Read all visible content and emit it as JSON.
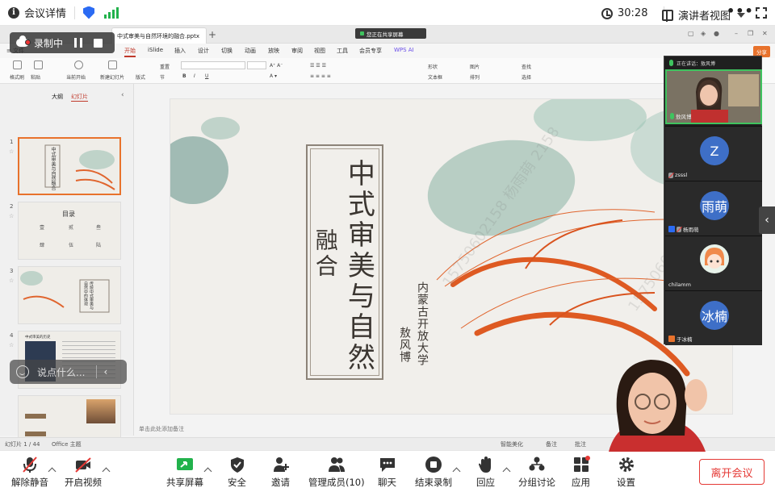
{
  "topbar": {
    "title": "会议详情",
    "timer": "30:28",
    "view_label": "演讲者视图",
    "more": "•••"
  },
  "recording": {
    "label": "录制中"
  },
  "wps": {
    "doc_tab": "中式审美与自然环境的融合.pptx",
    "share_banner": "您正在共享屏幕",
    "tabs": [
      "开始",
      "iSlide",
      "插入",
      "设计",
      "切换",
      "动画",
      "放映",
      "审阅",
      "视图",
      "工具",
      "会员专享",
      "WPS AI"
    ],
    "active_tab": "开始",
    "share_button": "分享",
    "ribbon": {
      "from_current": "当前开始",
      "new_slide": "新建幻灯片",
      "format_painter": "格式刷",
      "paste": "粘贴",
      "layout": "版式",
      "section": "节",
      "reset": "重置",
      "shape": "形状",
      "picture": "图片",
      "textbox": "文本框",
      "arrange": "排列",
      "find": "查找",
      "select": "选择"
    },
    "pane_tabs": [
      "大纲",
      "幻灯片"
    ],
    "active_pane_tab": "幻灯片",
    "thumbnails": [
      {
        "num": "1",
        "title": "中式审美与自然融合"
      },
      {
        "num": "2",
        "title": "目录",
        "items": [
          "叁",
          "贰",
          "壹",
          "肆",
          "伍",
          "陆"
        ]
      },
      {
        "num": "3",
        "title": "传统中式审美与自然中的体现"
      },
      {
        "num": "4",
        "title": "中式审美的历史"
      }
    ],
    "notes_placeholder": "单击此处添加备注",
    "status": {
      "slide_count": "幻灯片 1 / 44",
      "theme": "Office 主题",
      "beautify": "智能美化",
      "notes": "备注",
      "comments": "批注"
    }
  },
  "slide": {
    "title_line1": "中式审美与自然",
    "title_line2": "融合",
    "affiliation": "内蒙古开放大学",
    "author": "敖风博",
    "watermark": "15750602158 杨雨萌 2158"
  },
  "chat": {
    "placeholder": "说点什么..."
  },
  "participants": {
    "header": "正在讲话：敖风博",
    "list": [
      {
        "name": "敖风博",
        "avatar": "",
        "speaking": true
      },
      {
        "name": "zsssl",
        "avatar": "Z"
      },
      {
        "name": "杨雨萌",
        "avatar": "雨萌",
        "host": true
      },
      {
        "name": "chilamm",
        "avatar": ""
      },
      {
        "name": "于冰楠",
        "avatar": "冰楠",
        "cohost": true
      }
    ]
  },
  "toolbar": {
    "unmute": "解除静音",
    "start_video": "开启视频",
    "share_screen": "共享屏幕",
    "security": "安全",
    "invite": "邀请",
    "manage_members": "管理成员(10)",
    "chat": "聊天",
    "stop_recording": "结束录制",
    "reactions": "回应",
    "breakout": "分组讨论",
    "apps": "应用",
    "settings": "设置",
    "leave": "离开会议"
  },
  "colors": {
    "accent_red": "#e53935",
    "wps_red": "#c0392b",
    "share_green": "#22b24c",
    "speaking_green": "#3fc35f",
    "avatar_blue": "#3e6fc7"
  }
}
